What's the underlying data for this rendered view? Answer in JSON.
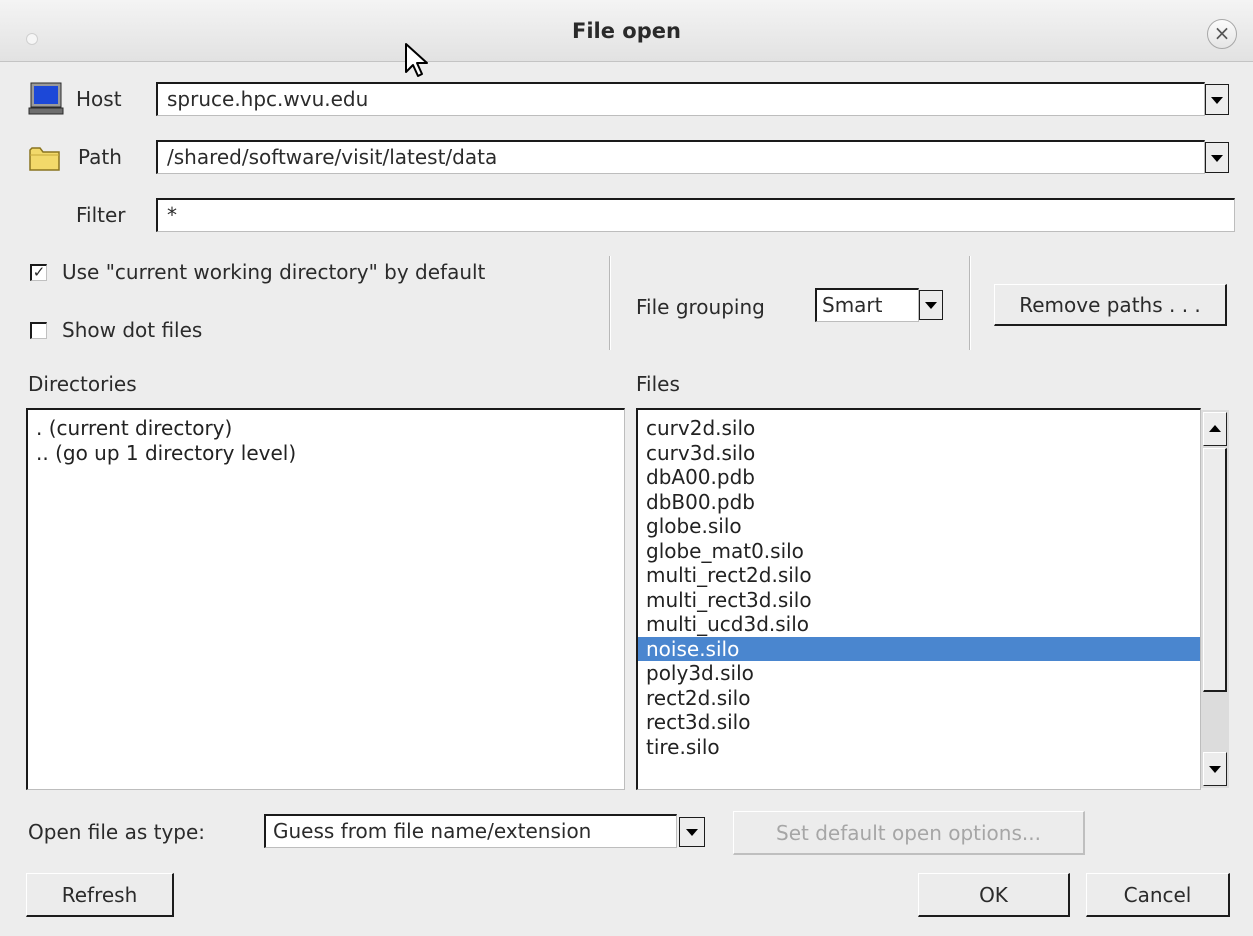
{
  "window": {
    "title": "File open"
  },
  "host": {
    "label": "Host",
    "value": "spruce.hpc.wvu.edu"
  },
  "path": {
    "label": "Path",
    "value": "/shared/software/visit/latest/data"
  },
  "filter": {
    "label": "Filter",
    "value": "*"
  },
  "options": {
    "use_cwd_label": "Use \"current working directory\" by default",
    "use_cwd_checked": true,
    "show_dot_files_label": "Show dot files",
    "show_dot_files_checked": false,
    "file_grouping_label": "File grouping",
    "file_grouping_value": "Smart",
    "remove_paths_label": "Remove paths . . ."
  },
  "directories": {
    "label": "Directories",
    "items": [
      ". (current directory)",
      ".. (go up 1 directory level)"
    ]
  },
  "files": {
    "label": "Files",
    "items": [
      "curv2d.silo",
      "curv3d.silo",
      "dbA00.pdb",
      "dbB00.pdb",
      "globe.silo",
      "globe_mat0.silo",
      "multi_rect2d.silo",
      "multi_rect3d.silo",
      "multi_ucd3d.silo",
      "noise.silo",
      "poly3d.silo",
      "rect2d.silo",
      "rect3d.silo",
      "tire.silo"
    ],
    "selected": "noise.silo"
  },
  "open_as": {
    "label": "Open file as type:",
    "value": "Guess from file name/extension",
    "set_default_label": "Set default open options..."
  },
  "buttons": {
    "refresh": "Refresh",
    "ok": "OK",
    "cancel": "Cancel"
  },
  "colors": {
    "selection": "#4a86cf",
    "background": "#ededed"
  },
  "icons": {
    "host": "computer-monitor-icon",
    "path": "folder-icon",
    "close": "close-icon"
  }
}
